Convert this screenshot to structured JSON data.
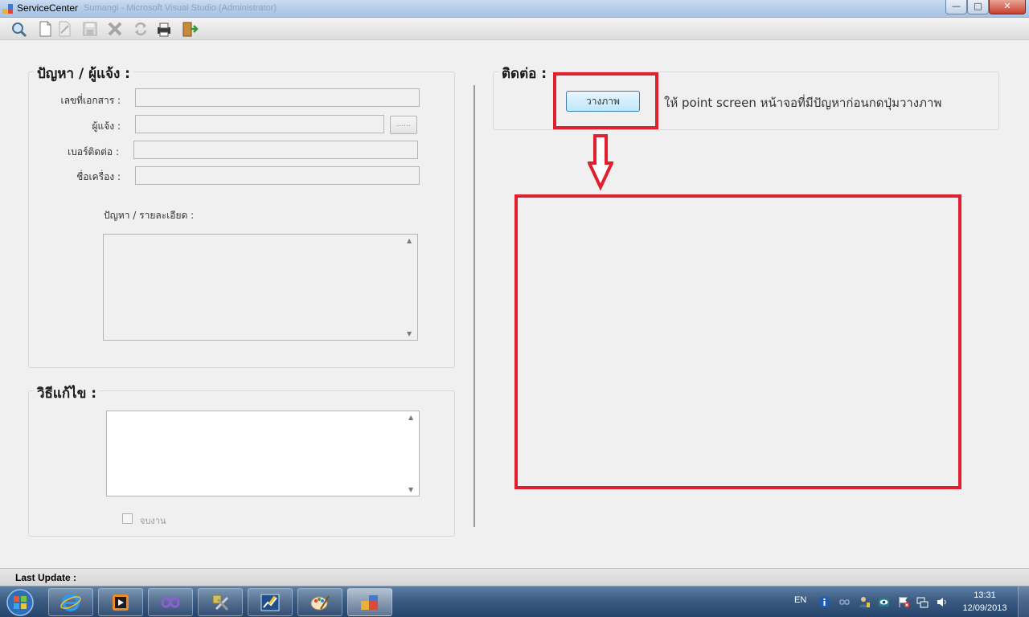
{
  "window": {
    "title": "ServiceCenter",
    "ghost_title": "Sumangi - Microsoft Visual Studio (Administrator)",
    "minimize": "—",
    "maximize": "□",
    "close": "✕"
  },
  "toolbar": {
    "items": [
      "search-icon",
      "new-document-icon",
      "edit-icon",
      "save-icon",
      "delete-icon",
      "refresh-icon",
      "print-icon",
      "exit-icon"
    ]
  },
  "problem_group": {
    "title": "ปัญหา / ผู้แจ้ง :",
    "doc_no_label": "เลขที่เอกสาร :",
    "doc_no_value": "",
    "reporter_label": "ผู้แจ้ง :",
    "reporter_value": "",
    "browse_label": "......",
    "phone_label": "เบอร์ติดต่อ :",
    "phone_value": "",
    "machine_label": "ชื่อเครื่อง :",
    "machine_value": "",
    "detail_label": "ปัญหา / รายละเอียด :",
    "detail_value": ""
  },
  "solution_group": {
    "title": "วิธีแก้ไข :",
    "solution_value": "",
    "done_label": "จบงาน"
  },
  "contact_group": {
    "title": "ติดต่อ :",
    "paste_button": "วางภาพ",
    "hint": "ให้  point screen หน้าจอที่มีปัญหาก่อนกดปุ่มวางภาพ"
  },
  "status": {
    "last_update_label": "Last Update :"
  },
  "taskbar": {
    "apps": [
      "internet-explorer-icon",
      "media-player-icon",
      "visual-studio-icon",
      "tools-icon",
      "chart-app-icon",
      "paint-icon",
      "service-center-icon"
    ],
    "language": "EN",
    "time": "13:31",
    "date": "12/09/2013"
  },
  "colors": {
    "annotation_red": "#e0202e",
    "window_bg": "#f0f0f0",
    "taskbar": "#3c5b81"
  }
}
